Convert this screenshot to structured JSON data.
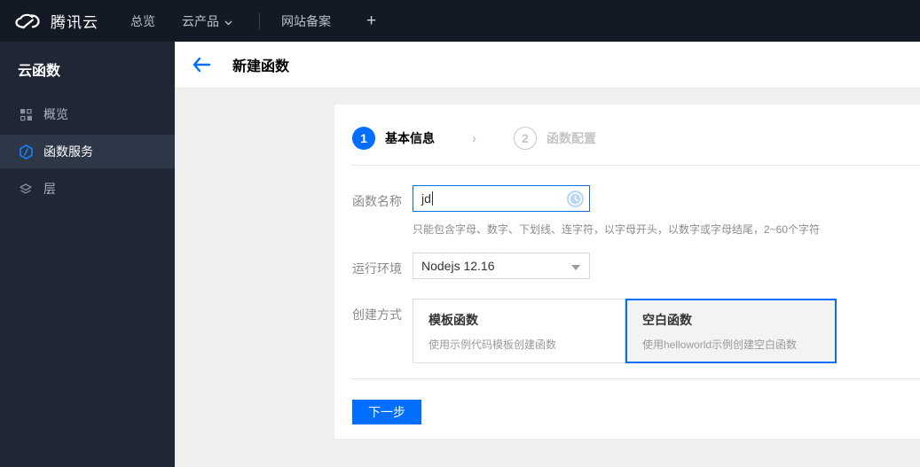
{
  "colors": {
    "accent": "#006eff",
    "topbar_bg": "#131a26",
    "sidebar_bg": "#202734"
  },
  "topbar": {
    "brand": "腾讯云",
    "nav": [
      {
        "label": "总览"
      },
      {
        "label": "云产品"
      },
      {
        "label": "网站备案"
      }
    ],
    "plus_label": "+"
  },
  "sidebar": {
    "title": "云函数",
    "items": [
      {
        "label": "概览",
        "selected": false
      },
      {
        "label": "函数服务",
        "selected": true
      },
      {
        "label": "层",
        "selected": false
      }
    ]
  },
  "header": {
    "title": "新建函数"
  },
  "wizard": {
    "steps": [
      {
        "number": "1",
        "label": "基本信息",
        "active": true
      },
      {
        "number": "2",
        "label": "函数配置",
        "active": false
      }
    ],
    "form": {
      "name": {
        "label": "函数名称",
        "value": "jd",
        "help": "只能包含字母、数字、下划线、连字符，以字母开头，以数字或字母结尾，2~60个字符"
      },
      "runtime": {
        "label": "运行环境",
        "value": "Nodejs 12.16"
      },
      "method": {
        "label": "创建方式",
        "options": [
          {
            "title": "模板函数",
            "desc": "使用示例代码模板创建函数",
            "selected": false
          },
          {
            "title": "空白函数",
            "desc": "使用helloworld示例创建空白函数",
            "selected": true
          }
        ]
      }
    },
    "next_button": "下一步"
  }
}
